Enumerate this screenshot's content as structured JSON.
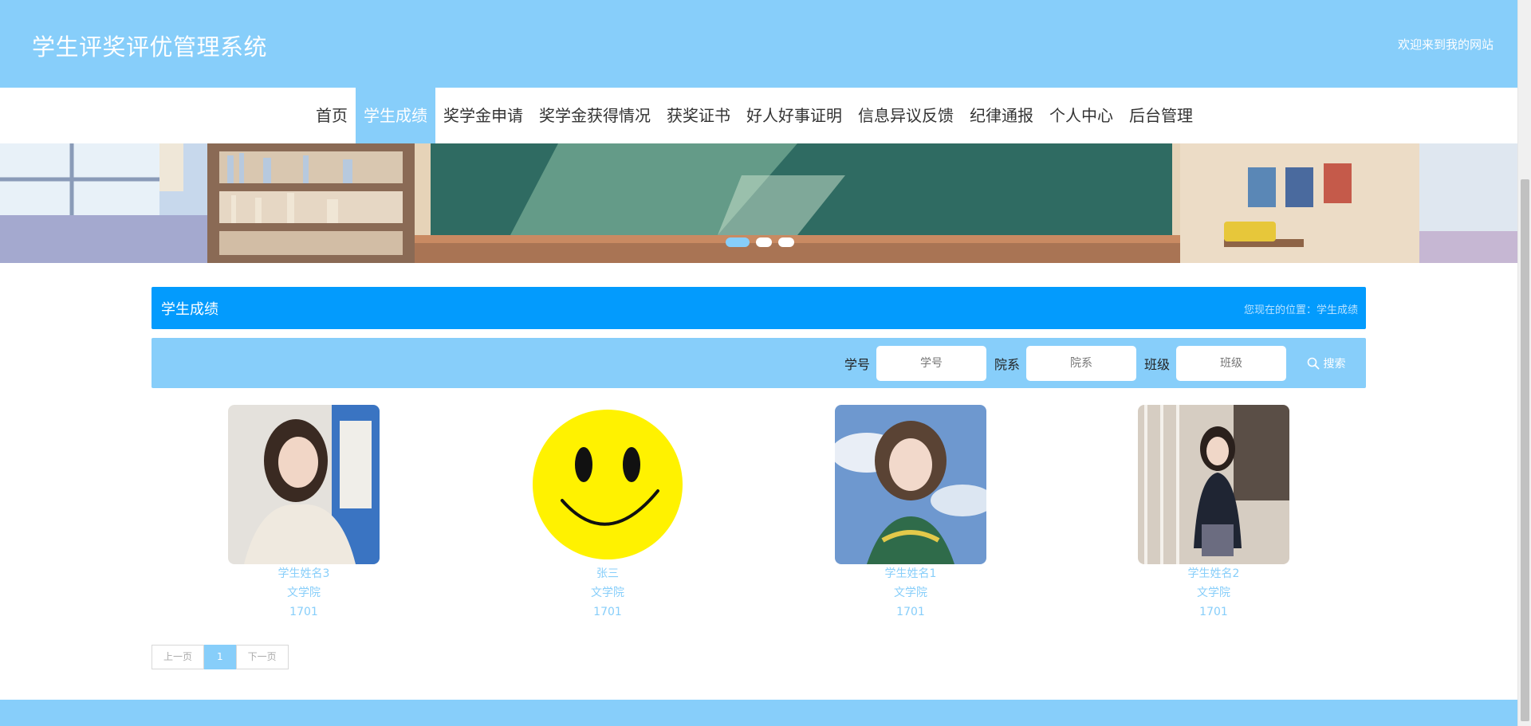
{
  "header": {
    "title": "学生评奖评优管理系统",
    "welcome": "欢迎来到我的网站"
  },
  "nav": {
    "items": [
      {
        "label": "首页"
      },
      {
        "label": "学生成绩",
        "active": true
      },
      {
        "label": "奖学金申请"
      },
      {
        "label": "奖学金获得情况"
      },
      {
        "label": "获奖证书"
      },
      {
        "label": "好人好事证明"
      },
      {
        "label": "信息异议反馈"
      },
      {
        "label": "纪律通报"
      },
      {
        "label": "个人中心"
      },
      {
        "label": "后台管理"
      }
    ]
  },
  "banner": {
    "slide_count": 3,
    "active_slide": 1
  },
  "section": {
    "title": "学生成绩",
    "breadcrumb": "您现在的位置：学生成绩"
  },
  "search": {
    "fields": [
      {
        "label": "学号",
        "placeholder": "学号"
      },
      {
        "label": "院系",
        "placeholder": "院系"
      },
      {
        "label": "班级",
        "placeholder": "班级"
      }
    ],
    "button_label": "搜索"
  },
  "students": [
    {
      "name": "学生姓名3",
      "department": "文学院",
      "class": "1701"
    },
    {
      "name": "张三",
      "department": "文学院",
      "class": "1701"
    },
    {
      "name": "学生姓名1",
      "department": "文学院",
      "class": "1701"
    },
    {
      "name": "学生姓名2",
      "department": "文学院",
      "class": "1701"
    }
  ],
  "pagination": {
    "prev": "上一页",
    "current": "1",
    "next": "下一页"
  },
  "colors": {
    "primary_light": "#87cefa",
    "primary": "#039bfd",
    "card_text": "#87cefa"
  }
}
